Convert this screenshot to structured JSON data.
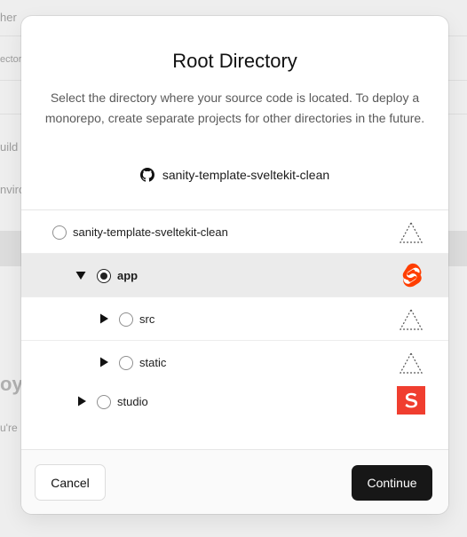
{
  "background": {
    "texts": [
      "her",
      "ector",
      "uild a",
      "nviro",
      "oy",
      "u're"
    ]
  },
  "modal": {
    "title": "Root Directory",
    "description": "Select the directory where your source code is located. To deploy a monorepo, create separate projects for other directories in the future.",
    "repo_icon": "github-icon",
    "repo_name": "sanity-template-sveltekit-clean"
  },
  "tree": {
    "items": [
      {
        "label": "sanity-template-sveltekit-clean",
        "selected": false,
        "expandable": false,
        "expanded": false,
        "framework_icon": "generic-framework-icon"
      },
      {
        "label": "app",
        "selected": true,
        "expandable": true,
        "expanded": true,
        "framework_icon": "svelte-icon",
        "framework_color": "#ff3e00"
      },
      {
        "label": "src",
        "selected": false,
        "expandable": true,
        "expanded": false,
        "framework_icon": "generic-framework-icon"
      },
      {
        "label": "static",
        "selected": false,
        "expandable": true,
        "expanded": false,
        "framework_icon": "generic-framework-icon"
      },
      {
        "label": "studio",
        "selected": false,
        "expandable": true,
        "expanded": false,
        "framework_icon": "sanity-icon",
        "framework_color": "#f03e2f"
      }
    ]
  },
  "footer": {
    "cancel_label": "Cancel",
    "continue_label": "Continue"
  },
  "colors": {
    "primary_button": "#171717",
    "selected_row": "#ebebeb",
    "svelte": "#ff3e00",
    "sanity": "#f03e2f"
  }
}
